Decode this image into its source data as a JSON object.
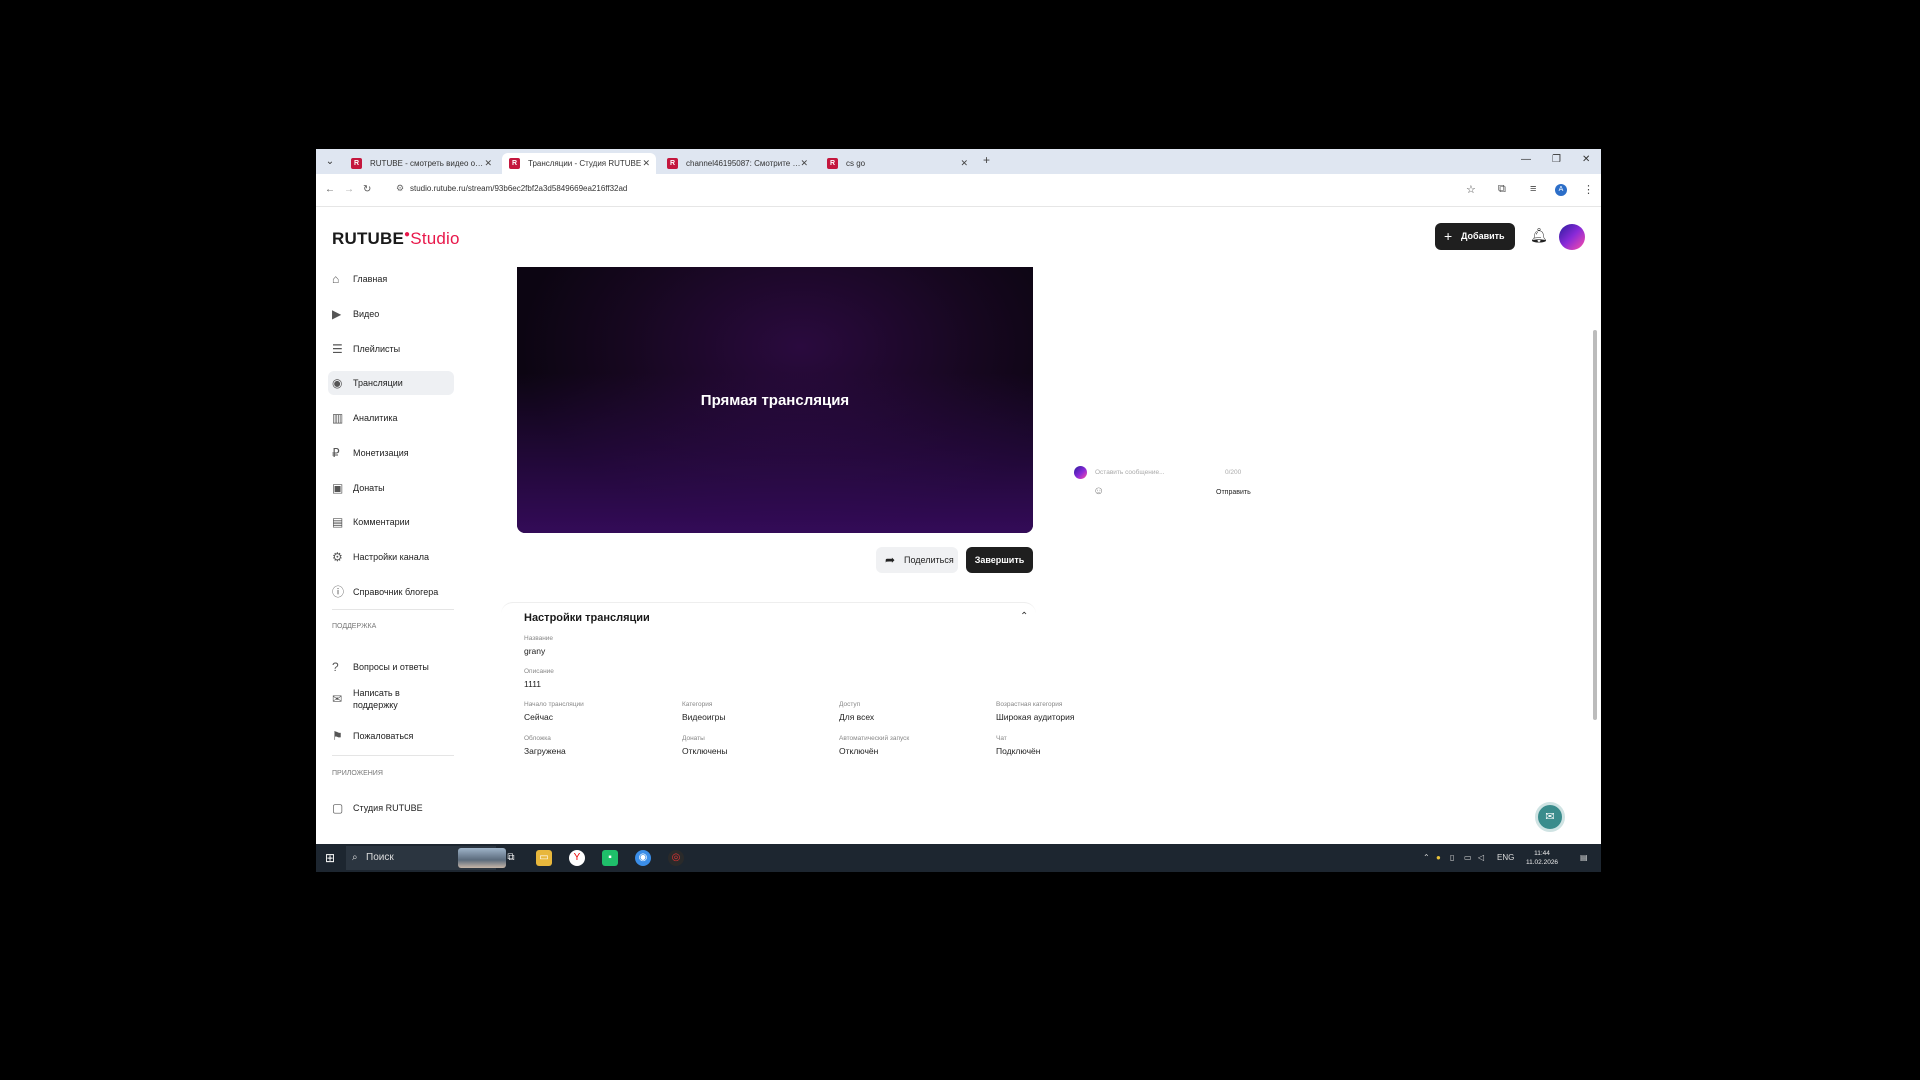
{
  "browser": {
    "tabs": [
      {
        "title": "RUTUBE - смотреть видео он...",
        "active": false
      },
      {
        "title": "Трансляции - Студия RUTUBE",
        "active": true
      },
      {
        "title": "channel46195087: Смотрите о...",
        "active": false
      },
      {
        "title": "cs go",
        "active": false
      }
    ],
    "url": "studio.rutube.ru/stream/93b6ec2fbf2a3d5849669ea216ff32ad"
  },
  "header": {
    "logo_main": "RUTUBE",
    "logo_studio": "Studio",
    "add_label": "Добавить"
  },
  "sidebar": {
    "items": [
      {
        "label": "Главная",
        "icon": "home-icon"
      },
      {
        "label": "Видео",
        "icon": "video-icon"
      },
      {
        "label": "Плейлисты",
        "icon": "playlist-icon"
      },
      {
        "label": "Трансляции",
        "icon": "broadcast-icon",
        "active": true
      },
      {
        "label": "Аналитика",
        "icon": "analytics-icon"
      },
      {
        "label": "Монетизация",
        "icon": "ruble-icon"
      },
      {
        "label": "Донаты",
        "icon": "gift-icon"
      },
      {
        "label": "Комментарии",
        "icon": "comment-icon"
      },
      {
        "label": "Настройки канала",
        "icon": "gear-icon"
      },
      {
        "label": "Справочник блогера",
        "icon": "info-icon"
      }
    ],
    "support_section": "ПОДДЕРЖКА",
    "support_items": [
      {
        "label": "Вопросы и ответы",
        "icon": "question-icon"
      },
      {
        "label": "Написать в поддержку",
        "icon": "mail-icon"
      },
      {
        "label": "Пожаловаться",
        "icon": "flag-icon"
      }
    ],
    "apps_section": "ПРИЛОЖЕНИЯ",
    "apps_items": [
      {
        "label": "Студия RUTUBE",
        "icon": "app-icon"
      }
    ]
  },
  "player": {
    "title": "Прямая трансляция"
  },
  "actions": {
    "share_label": "Поделиться",
    "finish_label": "Завершить"
  },
  "chat": {
    "placeholder": "Оставить сообщение...",
    "counter": "0/200",
    "send_label": "Отправить"
  },
  "settings": {
    "title": "Настройки трансляции",
    "name_label": "Название",
    "name_value": "grany",
    "desc_label": "Описание",
    "desc_value": "1111",
    "fields": [
      {
        "label": "Начало трансляции",
        "value": "Сейчас"
      },
      {
        "label": "Категория",
        "value": "Видеоигры"
      },
      {
        "label": "Доступ",
        "value": "Для всех"
      },
      {
        "label": "Возрастная категория",
        "value": "Широкая аудитория"
      },
      {
        "label": "Обложка",
        "value": "Загружена"
      },
      {
        "label": "Донаты",
        "value": "Отключены"
      },
      {
        "label": "Автоматический запуск",
        "value": "Отключён"
      },
      {
        "label": "Чат",
        "value": "Подключён"
      }
    ]
  },
  "taskbar": {
    "search_label": "Поиск",
    "lang": "ENG",
    "time": "11:44",
    "date": "11.02.2026"
  }
}
